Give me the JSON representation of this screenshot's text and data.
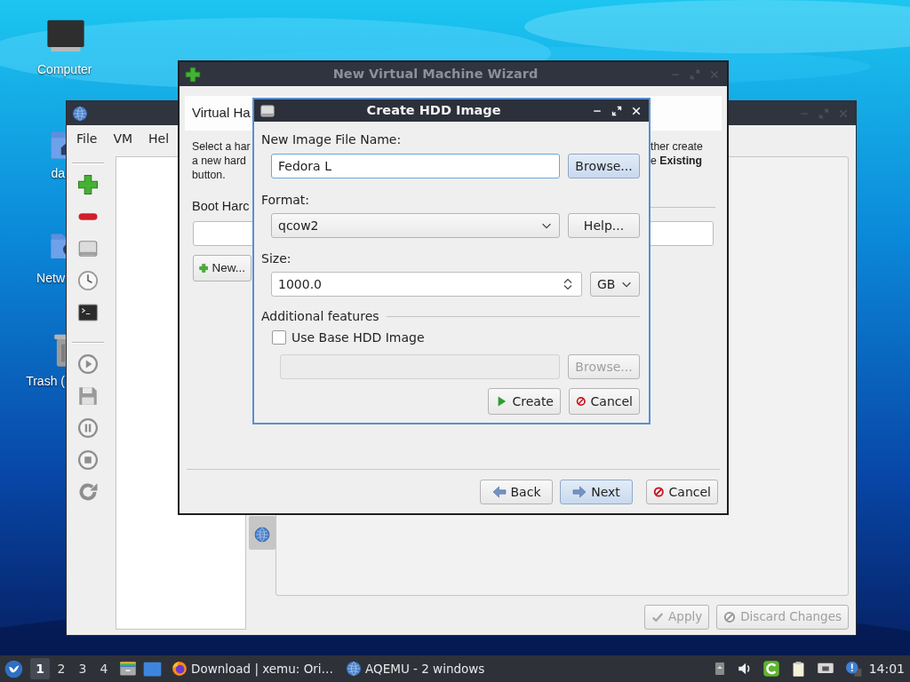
{
  "desktop_icons": [
    {
      "label": "Computer",
      "kind": "computer"
    },
    {
      "label": "da",
      "kind": "home"
    },
    {
      "label": "Netw",
      "kind": "network"
    },
    {
      "label": "Trash (",
      "kind": "trash"
    }
  ],
  "main_window": {
    "active": false,
    "menu": [
      "File",
      "VM",
      "Hel"
    ],
    "buttons": [
      {
        "label": "Apply",
        "kind": "apply",
        "disabled": true
      },
      {
        "label": "Discard Changes",
        "kind": "discard",
        "disabled": true
      }
    ]
  },
  "wizard": {
    "title": "New Virtual Machine Wizard",
    "active": false,
    "page_title": "Virtual Ha",
    "description_left": [
      "Select a har",
      "a new hard",
      "button."
    ],
    "description_right": [
      "ther create",
      "e **Existing**"
    ],
    "group_label": "Boot Harc",
    "new_button": "New...",
    "buttons": [
      {
        "label": "Back",
        "kind": "back",
        "highlighted": false
      },
      {
        "label": "Next",
        "kind": "next",
        "highlighted": true
      },
      {
        "label": "Cancel",
        "kind": "cancel",
        "highlighted": false
      }
    ]
  },
  "dialog": {
    "title": "Create HDD Image",
    "active": true,
    "file_name_label": "New Image File Name:",
    "file_name": "Fedora L",
    "browse_button": {
      "label": "Browse...",
      "highlighted": true
    },
    "format_label": "Format:",
    "format": "qcow2",
    "help_button": {
      "label": "Help...",
      "highlighted": false
    },
    "size_label": "Size:",
    "size": "1000.0",
    "size_unit": "GB",
    "additional_features_label": "Additional features",
    "use_base_image": {
      "label": "Use Base HDD Image",
      "checked": false
    },
    "base_browse_button": "Browse...",
    "buttons": [
      {
        "label": "Create",
        "kind": "create"
      },
      {
        "label": "Cancel",
        "kind": "cancel"
      }
    ]
  },
  "taskbar": {
    "workspaces": [
      {
        "label": "1",
        "selected": true
      },
      {
        "label": "2",
        "selected": false
      },
      {
        "label": "3",
        "selected": false
      },
      {
        "label": "4",
        "selected": false
      }
    ],
    "tasks": [
      {
        "label": "Download | xemu: Ori…",
        "kind": "browser"
      },
      {
        "label": "AQEMU - 2 windows",
        "kind": "app"
      }
    ],
    "clock": "14:01"
  }
}
